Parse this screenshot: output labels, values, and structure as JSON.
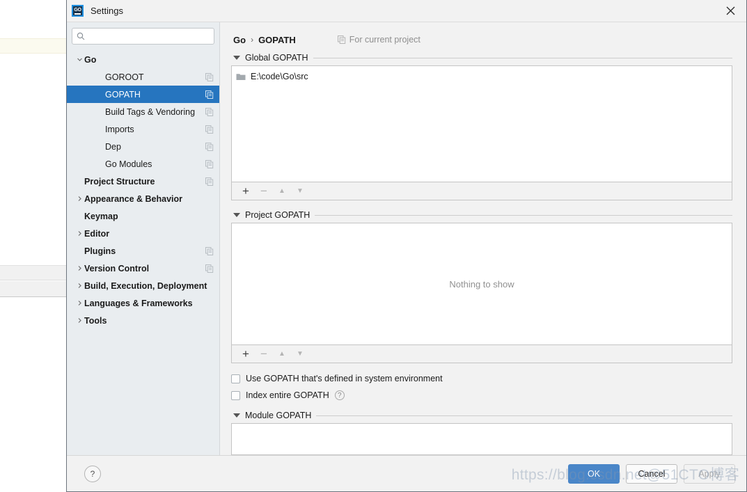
{
  "window": {
    "title": "Settings",
    "app_icon": "goland-icon",
    "app_icon_text": "GO",
    "close_icon": "close-icon"
  },
  "sidebar": {
    "search": {
      "value": "",
      "placeholder": "",
      "icon": "search-icon"
    },
    "items": [
      {
        "label": "Go",
        "bold": true,
        "arrow": "chevron-down",
        "indent": 0,
        "copy": false,
        "selected": false
      },
      {
        "label": "GOROOT",
        "bold": false,
        "arrow": "",
        "indent": 1,
        "copy": true,
        "selected": false
      },
      {
        "label": "GOPATH",
        "bold": false,
        "arrow": "",
        "indent": 1,
        "copy": true,
        "selected": true
      },
      {
        "label": "Build Tags & Vendoring",
        "bold": false,
        "arrow": "",
        "indent": 1,
        "copy": true,
        "selected": false
      },
      {
        "label": "Imports",
        "bold": false,
        "arrow": "",
        "indent": 1,
        "copy": true,
        "selected": false
      },
      {
        "label": "Dep",
        "bold": false,
        "arrow": "",
        "indent": 1,
        "copy": true,
        "selected": false
      },
      {
        "label": "Go Modules",
        "bold": false,
        "arrow": "",
        "indent": 1,
        "copy": true,
        "selected": false
      },
      {
        "label": "Project Structure",
        "bold": true,
        "arrow": "",
        "indent": 0,
        "copy": true,
        "selected": false
      },
      {
        "label": "Appearance & Behavior",
        "bold": true,
        "arrow": "chevron-right",
        "indent": 0,
        "copy": false,
        "selected": false
      },
      {
        "label": "Keymap",
        "bold": true,
        "arrow": "",
        "indent": 0,
        "copy": false,
        "selected": false
      },
      {
        "label": "Editor",
        "bold": true,
        "arrow": "chevron-right",
        "indent": 0,
        "copy": false,
        "selected": false
      },
      {
        "label": "Plugins",
        "bold": true,
        "arrow": "",
        "indent": 0,
        "copy": true,
        "selected": false
      },
      {
        "label": "Version Control",
        "bold": true,
        "arrow": "chevron-right",
        "indent": 0,
        "copy": true,
        "selected": false
      },
      {
        "label": "Build, Execution, Deployment",
        "bold": true,
        "arrow": "chevron-right",
        "indent": 0,
        "copy": false,
        "selected": false
      },
      {
        "label": "Languages & Frameworks",
        "bold": true,
        "arrow": "chevron-right",
        "indent": 0,
        "copy": false,
        "selected": false
      },
      {
        "label": "Tools",
        "bold": true,
        "arrow": "chevron-right",
        "indent": 0,
        "copy": false,
        "selected": false
      }
    ]
  },
  "content": {
    "breadcrumb": {
      "parent": "Go",
      "separator": "›",
      "current": "GOPATH"
    },
    "for_current_project": {
      "label": "For current project",
      "icon": "copy-icon"
    },
    "global_gopath": {
      "title": "Global GOPATH",
      "items": [
        {
          "path": "E:\\code\\Go\\src",
          "icon": "folder-icon"
        }
      ],
      "toolbar": [
        {
          "name": "add-button",
          "glyph": "+",
          "enabled": true
        },
        {
          "name": "remove-button",
          "glyph": "−",
          "enabled": false
        },
        {
          "name": "move-up-button",
          "glyph": "▲",
          "enabled": false
        },
        {
          "name": "move-down-button",
          "glyph": "▼",
          "enabled": false
        }
      ]
    },
    "project_gopath": {
      "title": "Project GOPATH",
      "empty_message": "Nothing to show",
      "items": [],
      "toolbar": [
        {
          "name": "add-button",
          "glyph": "+",
          "enabled": true
        },
        {
          "name": "remove-button",
          "glyph": "−",
          "enabled": false
        },
        {
          "name": "move-up-button",
          "glyph": "▲",
          "enabled": false
        },
        {
          "name": "move-down-button",
          "glyph": "▼",
          "enabled": false
        }
      ]
    },
    "checkboxes": [
      {
        "label": "Use GOPATH that's defined in system environment",
        "checked": false,
        "help": false
      },
      {
        "label": "Index entire GOPATH",
        "checked": false,
        "help": true
      }
    ],
    "module_gopath": {
      "title": "Module GOPATH"
    }
  },
  "footer": {
    "help_label": "?",
    "buttons": [
      {
        "label": "OK",
        "style": "primary"
      },
      {
        "label": "Cancel",
        "style": "default"
      },
      {
        "label": "Apply",
        "style": "disabled"
      }
    ]
  },
  "watermark": {
    "text": "https://blog.csdn.net@51CTO博客"
  },
  "colors": {
    "accent": "#2675bf",
    "ok_button": "#4a86c8",
    "sidebar_bg": "#e9edf0",
    "dialog_bg": "#f2f2f2"
  }
}
